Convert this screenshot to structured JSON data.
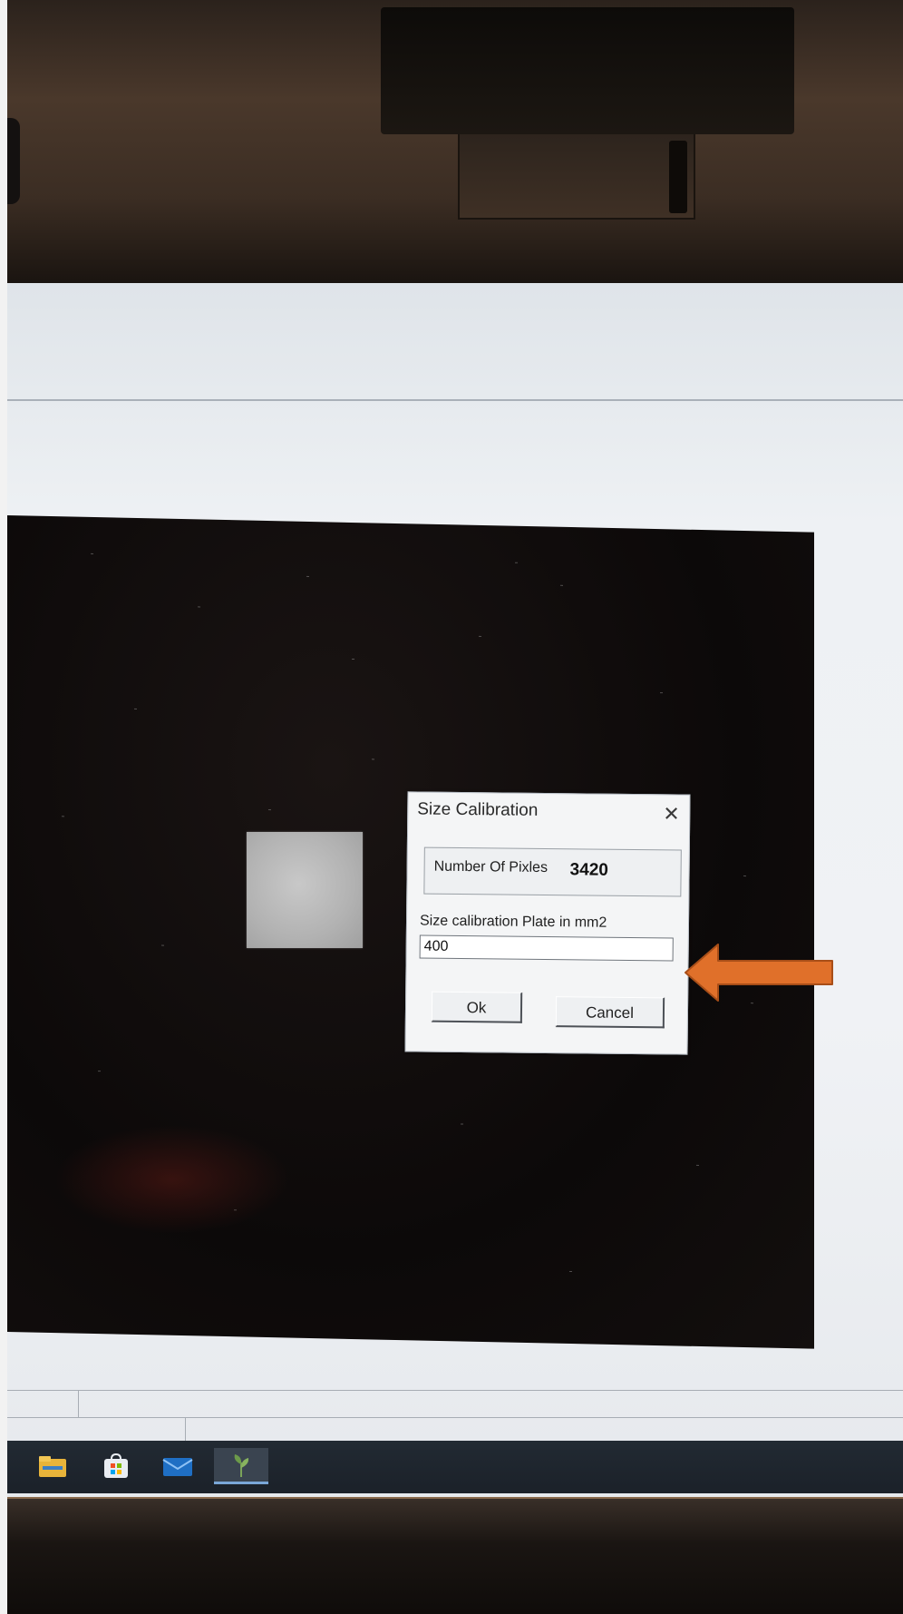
{
  "dialog": {
    "title": "Size Calibration",
    "close_glyph": "✕",
    "pixels_label": "Number Of Pixles",
    "pixels_value": "3420",
    "size_label": "Size calibration Plate in mm2",
    "size_value": "400",
    "ok_label": "Ok",
    "cancel_label": "Cancel"
  },
  "annotation": {
    "arrow_color": "#e0702a",
    "arrow_icon": "arrow-left-icon"
  },
  "taskbar": {
    "items": [
      {
        "icon": "file-explorer-icon"
      },
      {
        "icon": "store-icon"
      },
      {
        "icon": "mail-icon"
      },
      {
        "icon": "app-leaf-icon"
      }
    ]
  }
}
